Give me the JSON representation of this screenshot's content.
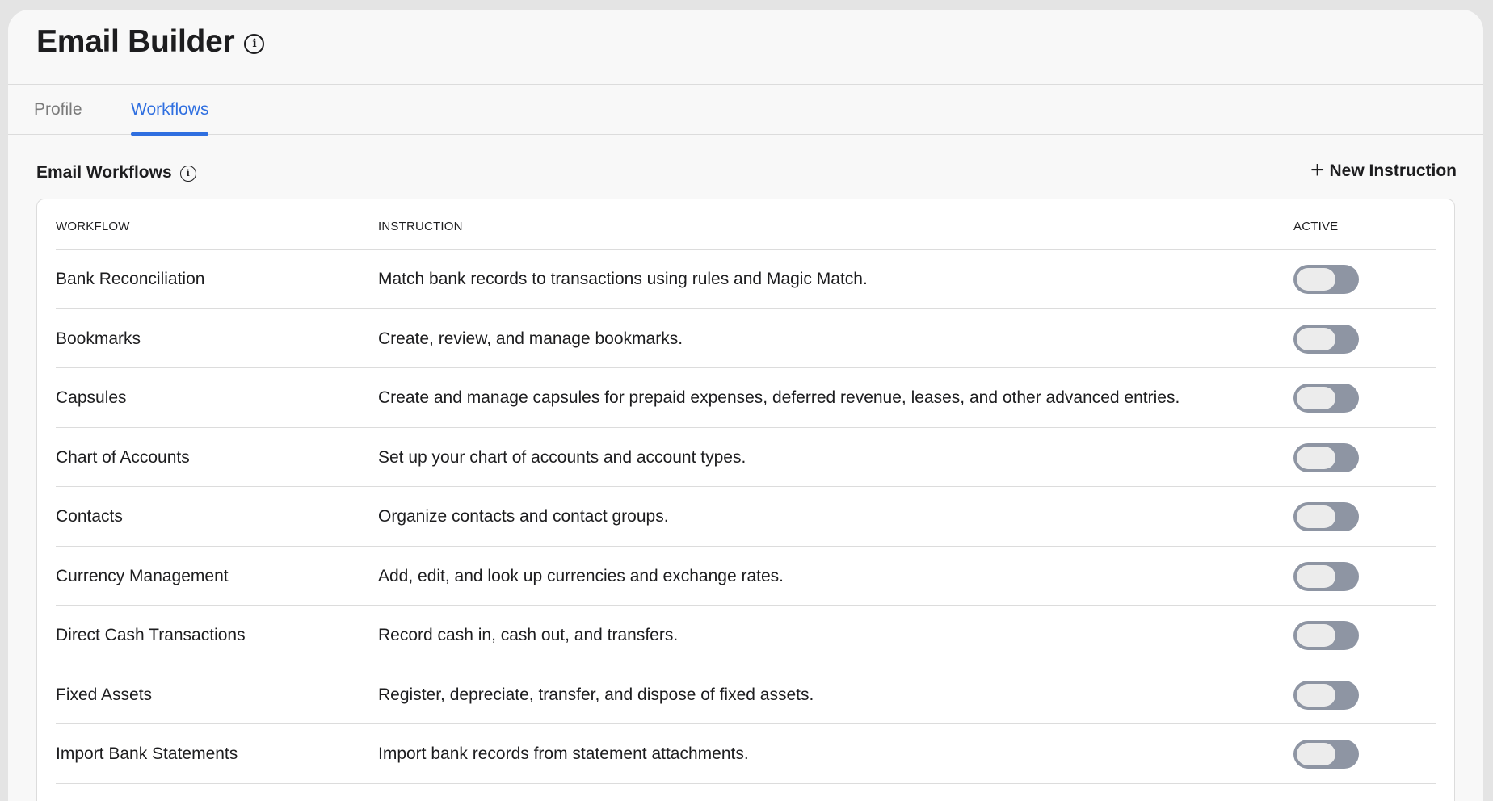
{
  "header": {
    "title": "Email Builder",
    "info_icon": "info-icon"
  },
  "tabs": [
    {
      "label": "Profile",
      "active": false
    },
    {
      "label": "Workflows",
      "active": true
    }
  ],
  "section": {
    "title": "Email Workflows",
    "new_button": "New Instruction",
    "new_icon": "plus-icon"
  },
  "table": {
    "columns": [
      "WORKFLOW",
      "INSTRUCTION",
      "ACTIVE"
    ],
    "rows": [
      {
        "workflow": "Bank Reconciliation",
        "instruction": "Match bank records to transactions using rules and Magic Match.",
        "active": false
      },
      {
        "workflow": "Bookmarks",
        "instruction": "Create, review, and manage bookmarks.",
        "active": false
      },
      {
        "workflow": "Capsules",
        "instruction": "Create and manage capsules for prepaid expenses, deferred revenue, leases, and other advanced entries.",
        "active": false
      },
      {
        "workflow": "Chart of Accounts",
        "instruction": "Set up your chart of accounts and account types.",
        "active": false
      },
      {
        "workflow": "Contacts",
        "instruction": "Organize contacts and contact groups.",
        "active": false
      },
      {
        "workflow": "Currency Management",
        "instruction": "Add, edit, and look up currencies and exchange rates.",
        "active": false
      },
      {
        "workflow": "Direct Cash Transactions",
        "instruction": "Record cash in, cash out, and transfers.",
        "active": false
      },
      {
        "workflow": "Fixed Assets",
        "instruction": "Register, depreciate, transfer, and dispose of fixed assets.",
        "active": false
      },
      {
        "workflow": "Import Bank Statements",
        "instruction": "Import bank records from statement attachments.",
        "active": false
      }
    ]
  },
  "colors": {
    "accent": "#2f6fe0",
    "toggle_off": "#8e95a3"
  }
}
